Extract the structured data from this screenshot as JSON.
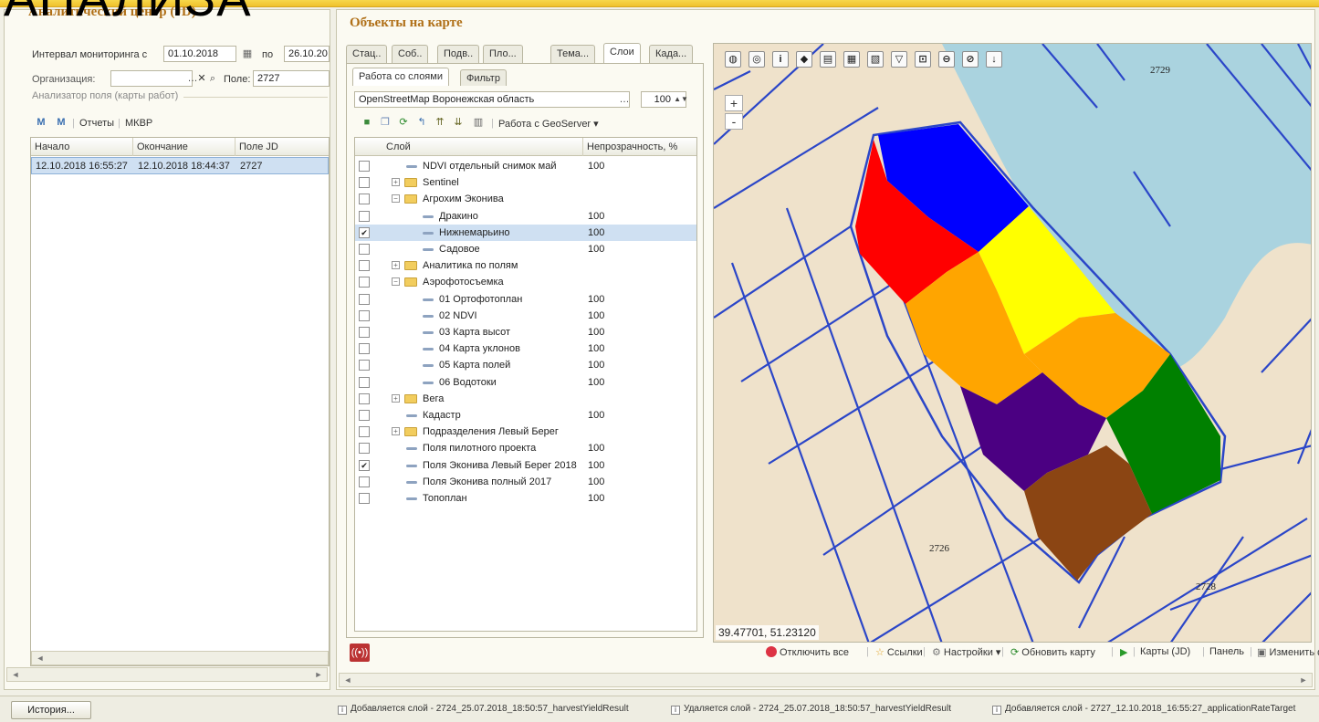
{
  "overlay_text": "АНАЛИЗА",
  "left": {
    "title": "Аналитический центр (JD)",
    "interval_label": "Интервал мониторинга с",
    "date_from": "01.10.2018",
    "to_label": "по",
    "date_to": "26.10.20",
    "org_label": "Организация:",
    "org_value": "",
    "field_label": "Поле:",
    "field_value": "2727",
    "group_label": "Анализатор поля (карты работ)",
    "toolbar": {
      "reports": "Отчеты",
      "mkvr": "МКВР"
    },
    "table": {
      "headers": [
        "Начало",
        "Окончание",
        "Поле JD"
      ],
      "rows": [
        [
          "12.10.2018 16:55:27",
          "12.10.2018 18:44:37",
          "2727"
        ]
      ]
    }
  },
  "main": {
    "title": "Объекты на карте",
    "tabs": [
      "Стац..",
      "Соб..",
      "Подв..",
      "Пло...",
      "Тема...",
      "Слои",
      "Када..."
    ],
    "subtabs": [
      "Работа со слоями",
      "Фильтр"
    ],
    "basemap": "OpenStreetMap Воронежская область",
    "opacity_value": "100",
    "geoserver": "Работа с GeoServer",
    "tree_headers": [
      "Слой",
      "Непрозрачность, %"
    ],
    "layers": [
      {
        "name": "NDVI   отдельный снимок май",
        "op": "100",
        "indent": 1,
        "type": "layer",
        "checked": false
      },
      {
        "name": "Sentinel",
        "op": "",
        "indent": 1,
        "type": "folder",
        "exp": "+",
        "checked": false
      },
      {
        "name": "Агрохим Эконива",
        "op": "",
        "indent": 1,
        "type": "folder",
        "exp": "−",
        "checked": false
      },
      {
        "name": "Дракино",
        "op": "100",
        "indent": 2,
        "type": "layer",
        "checked": false
      },
      {
        "name": "Нижнемарьино",
        "op": "100",
        "indent": 2,
        "type": "layer",
        "checked": true,
        "sel": true
      },
      {
        "name": "Садовое",
        "op": "100",
        "indent": 2,
        "type": "layer",
        "checked": false
      },
      {
        "name": "Аналитика по полям",
        "op": "",
        "indent": 1,
        "type": "folder",
        "exp": "+",
        "checked": false
      },
      {
        "name": "Аэрофотосъемка",
        "op": "",
        "indent": 1,
        "type": "folder",
        "exp": "−",
        "checked": false
      },
      {
        "name": "01 Ортофотоплан",
        "op": "100",
        "indent": 2,
        "type": "layer",
        "checked": false
      },
      {
        "name": "02 NDVI",
        "op": "100",
        "indent": 2,
        "type": "layer",
        "checked": false
      },
      {
        "name": "03 Карта высот",
        "op": "100",
        "indent": 2,
        "type": "layer",
        "checked": false
      },
      {
        "name": "04 Карта уклонов",
        "op": "100",
        "indent": 2,
        "type": "layer",
        "checked": false
      },
      {
        "name": "05 Карта полей",
        "op": "100",
        "indent": 2,
        "type": "layer",
        "checked": false
      },
      {
        "name": "06 Водотоки",
        "op": "100",
        "indent": 2,
        "type": "layer",
        "checked": false
      },
      {
        "name": "Вега",
        "op": "",
        "indent": 1,
        "type": "folder",
        "exp": "+",
        "checked": false
      },
      {
        "name": "Кадастр",
        "op": "100",
        "indent": 1,
        "type": "layer",
        "checked": false
      },
      {
        "name": "Подразделения Левый Берег",
        "op": "",
        "indent": 1,
        "type": "folder",
        "exp": "+",
        "checked": false
      },
      {
        "name": "Поля пилотного проекта",
        "op": "100",
        "indent": 1,
        "type": "layer",
        "checked": false
      },
      {
        "name": "Поля Эконива Левый Берег 2018",
        "op": "100",
        "indent": 1,
        "type": "layer",
        "checked": true
      },
      {
        "name": "Поля Эконива полный 2017",
        "op": "100",
        "indent": 1,
        "type": "layer",
        "checked": false
      },
      {
        "name": "Топоплан",
        "op": "100",
        "indent": 1,
        "type": "layer",
        "checked": false
      }
    ],
    "map": {
      "coords": "39.47701, 51.23120",
      "labels": [
        "2729",
        "2726",
        "2728"
      ],
      "zone_colors": [
        "#0000ff",
        "#ff0000",
        "#ffff00",
        "#ffa500",
        "#ffa500",
        "#4b0082",
        "#008000",
        "#8b4513"
      ],
      "map_colors": {
        "land": "#efe2cb",
        "water": "#aad3df",
        "border": "#2b46c8"
      },
      "tool_icons": [
        "globe-icon",
        "target-icon",
        "info-icon",
        "split-icon",
        "legend-icon",
        "layers-icon",
        "layers2-icon",
        "filter-icon",
        "extent-icon",
        "zoom-region-icon",
        "zoom-back-icon",
        "thermometer-icon"
      ],
      "zoom_in": "+",
      "zoom_out": "-"
    },
    "bottom": {
      "disable_all": "Отключить все",
      "links": "Ссылки",
      "settings": "Настройки",
      "refresh": "Обновить карту",
      "maps_jd": "Карты (JD)",
      "panel": "Панель",
      "change": "Изменить фо"
    }
  },
  "status": {
    "history_button": "История...",
    "messages": [
      "Добавляется слой - 2724_25.07.2018_18:50:57_harvestYieldResult",
      "Удаляется слой - 2724_25.07.2018_18:50:57_harvestYieldResult",
      "Добавляется слой - 2727_12.10.2018_16:55:27_applicationRateTarget"
    ]
  }
}
